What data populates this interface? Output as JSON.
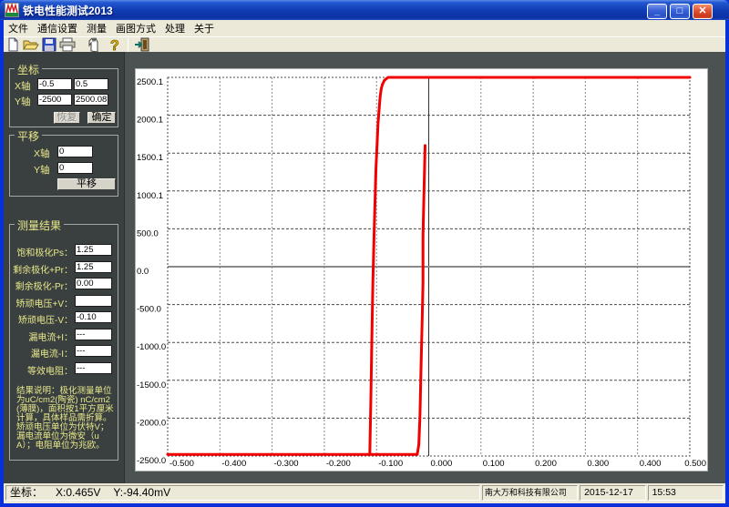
{
  "window": {
    "title": "铁电性能测试2013"
  },
  "menu": {
    "items": [
      "文件",
      "通信设置",
      "测量",
      "画图方式",
      "处理",
      "关于"
    ]
  },
  "toolbar": {
    "buttons": [
      "new",
      "open",
      "save",
      "print",
      "hand",
      "help",
      "exit"
    ]
  },
  "panels": {
    "coords": {
      "legend": "坐标",
      "x_label": "X轴",
      "y_label": "Y轴",
      "x_min": "-0.5",
      "x_max": "0.5",
      "y_min": "-2500",
      "y_max": "2500.08",
      "restore_label": "恢复",
      "confirm_label": "确定"
    },
    "pan": {
      "legend": "平移",
      "x_label": "X轴",
      "y_label": "Y轴",
      "x_value": "0",
      "y_value": "0",
      "button_label": "平移"
    },
    "results": {
      "legend": "测量结果",
      "rows": [
        {
          "label": "饱和极化Ps：",
          "value": "1.25"
        },
        {
          "label": "剩余极化+Pr：",
          "value": "1.25"
        },
        {
          "label": "剩余极化-Pr：",
          "value": "0.00"
        },
        {
          "label": "矫顽电压+V：",
          "value": ""
        },
        {
          "label": "矫顽电压-V：",
          "value": "-0.10"
        },
        {
          "label": "漏电流+I：",
          "value": "---"
        },
        {
          "label": "漏电流-I：",
          "value": "---"
        },
        {
          "label": "等效电阻：",
          "value": "---"
        }
      ],
      "note": "结果说明：极化测量单位为uC/cm2(陶瓷) nC/cm2(薄膜)，面积按1平方厘米计算，具体样品需折算。矫顽电压单位为伏特V；漏电流单位为微安（uA）；电阻单位为兆欧。"
    }
  },
  "chart_data": {
    "type": "line",
    "title": "",
    "xlabel": "",
    "ylabel": "",
    "xlim": [
      -0.5,
      0.5
    ],
    "ylim": [
      -2500.1,
      2500.1
    ],
    "grid": true,
    "x_ticks": [
      "-0.500",
      "-0.400",
      "-0.300",
      "-0.200",
      "-0.100",
      "0.000",
      "0.100",
      "0.200",
      "0.300",
      "0.400",
      "0.500"
    ],
    "y_ticks": [
      "2500.1",
      "2000.1",
      "1500.1",
      "1000.1",
      "500.0",
      "0.0",
      "-500.0",
      "-1000.0",
      "-1500.0",
      "-2000.0",
      "-2500.0"
    ],
    "series": [
      {
        "name": "hysteresis-loop",
        "color": "#f00000",
        "segments": [
          [
            [
              -0.007,
              1600
            ],
            [
              -0.009,
              1000
            ],
            [
              -0.011,
              400
            ],
            [
              -0.011,
              -200
            ],
            [
              -0.013,
              -800
            ],
            [
              -0.015,
              -1400
            ],
            [
              -0.017,
              -2000
            ],
            [
              -0.019,
              -2350
            ],
            [
              -0.022,
              -2480
            ],
            [
              -0.5,
              -2480
            ]
          ],
          [
            [
              -0.113,
              -2480
            ],
            [
              -0.111,
              -1800
            ],
            [
              -0.109,
              -1000
            ],
            [
              -0.107,
              -200
            ],
            [
              -0.104,
              600
            ],
            [
              -0.101,
              1300
            ],
            [
              -0.097,
              1900
            ],
            [
              -0.093,
              2250
            ],
            [
              -0.091,
              2350
            ],
            [
              -0.089,
              2400
            ],
            [
              -0.085,
              2460
            ],
            [
              -0.078,
              2500
            ],
            [
              0.5,
              2500
            ]
          ]
        ]
      }
    ]
  },
  "statusbar": {
    "coords_label": "坐标：",
    "coords_value_x": "X:0.465V",
    "coords_value_y": "Y:-94.40mV",
    "company": "南大万和科技有限公司",
    "date": "2015-12-17",
    "time": "15:53"
  }
}
